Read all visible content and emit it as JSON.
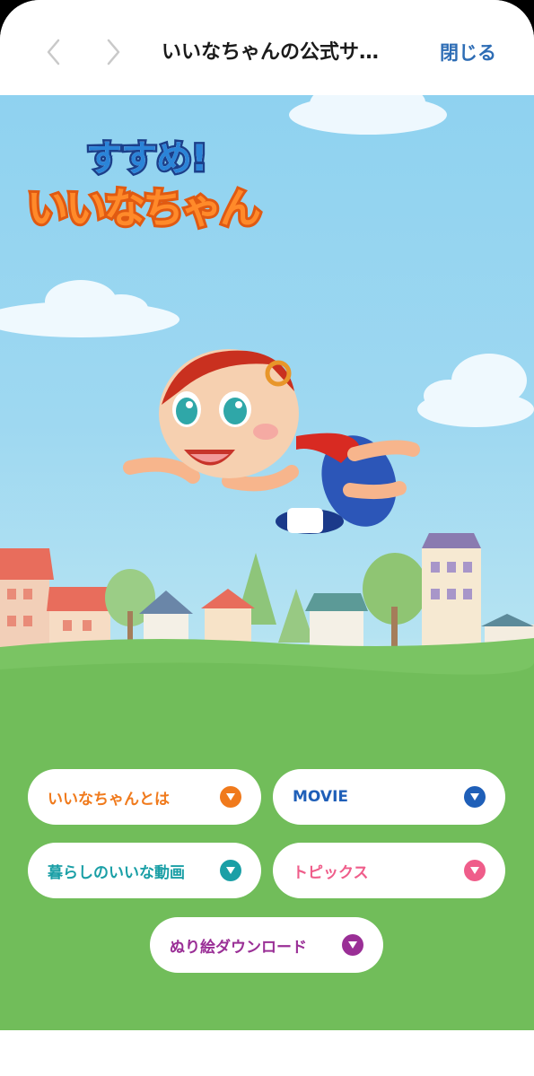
{
  "browser": {
    "title": "いいなちゃんの公式サ…",
    "close_label": "閉じる",
    "back_icon": "chevron-left-icon",
    "forward_icon": "chevron-right-icon"
  },
  "hero": {
    "logo_line1": "すすめ!",
    "logo_line2": "いいなちゃん",
    "colors": {
      "sky": "#8fd2f0",
      "grass": "#6fc15a",
      "logo_orange": "#ff8a2a",
      "logo_blue": "#2a84d8"
    }
  },
  "menu": [
    {
      "label": "いいなちゃんとは",
      "color": "#f07a1c",
      "icon": "chevron-down-icon"
    },
    {
      "label": "MOVIE",
      "color": "#1f5fb8",
      "icon": "chevron-down-icon"
    },
    {
      "label": "暮らしのいいな動画",
      "color": "#1a9fa6",
      "icon": "chevron-down-icon"
    },
    {
      "label": "トピックス",
      "color": "#ef5d8a",
      "icon": "chevron-down-icon"
    },
    {
      "label": "ぬり絵ダウンロード",
      "color": "#9a2f96",
      "icon": "chevron-down-icon"
    }
  ]
}
